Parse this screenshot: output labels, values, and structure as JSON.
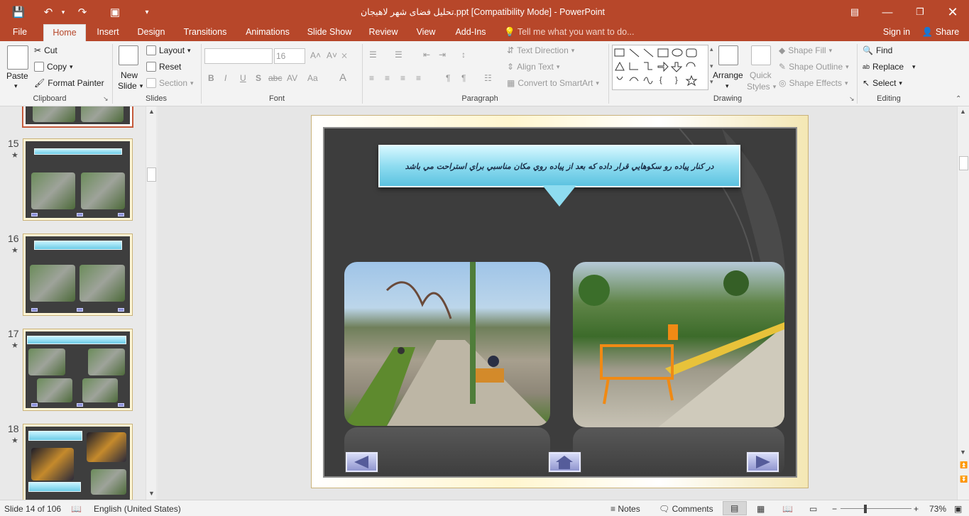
{
  "titlebar": {
    "title": "تحلیل فضای شهر لاهیجان.ppt [Compatibility Mode] - PowerPoint",
    "bg": "#b7472a"
  },
  "tabs": [
    {
      "label": "File"
    },
    {
      "label": "Home"
    },
    {
      "label": "Insert"
    },
    {
      "label": "Design"
    },
    {
      "label": "Transitions"
    },
    {
      "label": "Animations"
    },
    {
      "label": "Slide Show"
    },
    {
      "label": "Review"
    },
    {
      "label": "View"
    },
    {
      "label": "Add-Ins"
    }
  ],
  "tell_me": "Tell me what you want to do...",
  "account": {
    "sign_in": "Sign in",
    "share": "Share"
  },
  "ribbon": {
    "clipboard": {
      "paste": "Paste",
      "cut": "Cut",
      "copy": "Copy",
      "format_painter": "Format Painter",
      "label": "Clipboard"
    },
    "slides": {
      "new_slide_1": "New",
      "new_slide_2": "Slide",
      "layout": "Layout",
      "reset": "Reset",
      "section": "Section",
      "label": "Slides"
    },
    "font": {
      "size": "16",
      "label": "Font"
    },
    "paragraph": {
      "text_direction": "Text Direction",
      "align_text": "Align Text",
      "convert_smartart": "Convert to SmartArt",
      "label": "Paragraph"
    },
    "drawing": {
      "arrange": "Arrange",
      "quick_styles_1": "Quick",
      "quick_styles_2": "Styles",
      "shape_fill": "Shape Fill",
      "shape_outline": "Shape Outline",
      "shape_effects": "Shape Effects",
      "label": "Drawing"
    },
    "editing": {
      "find": "Find",
      "replace": "Replace",
      "select": "Select",
      "label": "Editing"
    }
  },
  "thumbnails": [
    {
      "num": "15"
    },
    {
      "num": "16"
    },
    {
      "num": "17"
    },
    {
      "num": "18"
    }
  ],
  "slide": {
    "banner_text": "در كنار پياده رو سكوهايي قرار داده كه بعد از پياده روي مكان مناسبي براي استراحت مي باشد"
  },
  "status": {
    "slide_info": "Slide 14 of 106",
    "language": "English (United States)",
    "notes": "Notes",
    "comments": "Comments",
    "zoom": "73%"
  }
}
